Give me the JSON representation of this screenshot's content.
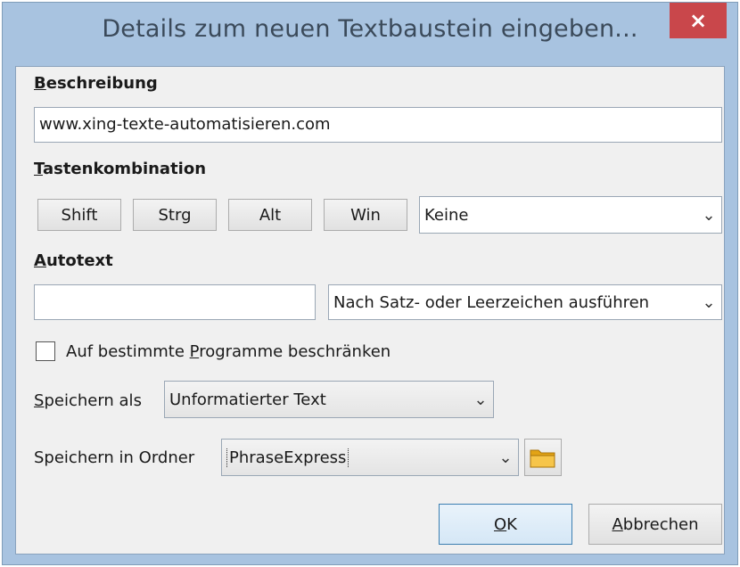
{
  "window": {
    "title": "Details zum neuen Textbaustein eingeben...",
    "close_label": "×"
  },
  "beschreibung": {
    "label_first": "B",
    "label_rest": "eschreibung",
    "value": "www.xing-texte-automatisieren.com"
  },
  "tastenkombination": {
    "label_first": "T",
    "label_rest": "astenkombination",
    "buttons": [
      "Shift",
      "Strg",
      "Alt",
      "Win"
    ],
    "key_value": "Keine"
  },
  "autotext": {
    "label_first": "A",
    "label_rest": "utotext",
    "value": "",
    "mode_value": "Nach Satz- oder Leerzeichen ausführen"
  },
  "restrict": {
    "pre": "Auf bestimmte ",
    "mnemonic": "P",
    "post": "rogramme beschränken"
  },
  "speichern_als": {
    "pre": "",
    "mnemonic": "S",
    "post": "peichern als",
    "value": "Unformatierter Text"
  },
  "speichern_in": {
    "label": "Speichern in Ordner",
    "value": "PhraseExpress"
  },
  "footer": {
    "ok_mnemonic": "O",
    "ok_rest": "K",
    "cancel_mnemonic": "A",
    "cancel_rest": "bbrechen"
  },
  "icons": {
    "dropdown": "chevron-down-icon",
    "folder": "folder-icon",
    "close": "close-icon"
  }
}
